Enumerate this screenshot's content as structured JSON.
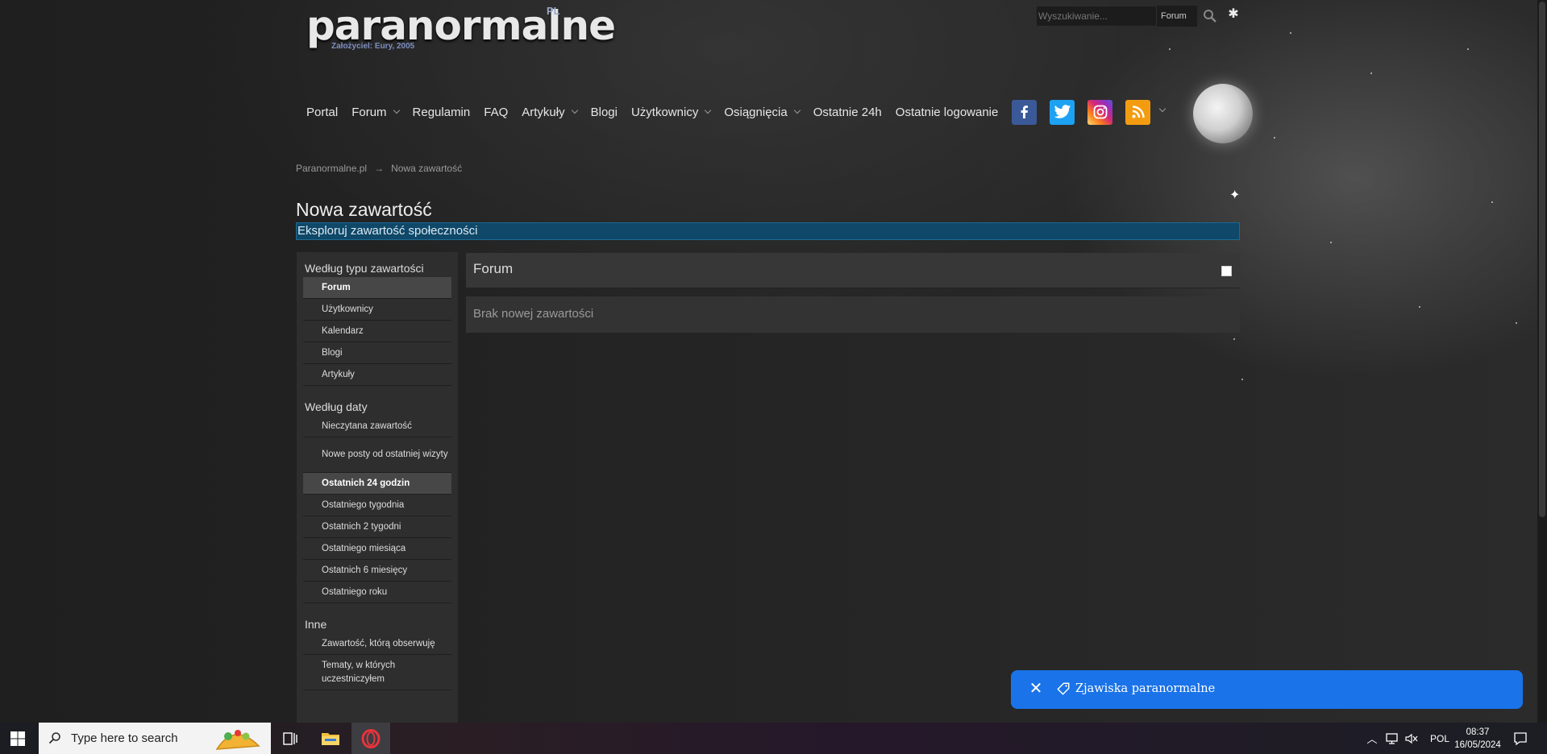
{
  "site": {
    "logo_text": "paranormalne",
    "logo_pl": "PL",
    "logo_sub": "Założyciel: Eury, 2005"
  },
  "search": {
    "placeholder": "Wyszukiwanie...",
    "scope": "Forum"
  },
  "nav": {
    "items": [
      {
        "label": "Portal",
        "dropdown": false
      },
      {
        "label": "Forum",
        "dropdown": true
      },
      {
        "label": "Regulamin",
        "dropdown": false
      },
      {
        "label": "FAQ",
        "dropdown": false
      },
      {
        "label": "Artykuły",
        "dropdown": true
      },
      {
        "label": "Blogi",
        "dropdown": false
      },
      {
        "label": "Użytkownicy",
        "dropdown": true
      },
      {
        "label": "Osiągnięcia",
        "dropdown": true
      },
      {
        "label": "Ostatnie 24h",
        "dropdown": false
      },
      {
        "label": "Ostatnie logowanie",
        "dropdown": false
      }
    ],
    "social": [
      {
        "name": "facebook-icon",
        "color": "#3b5998"
      },
      {
        "name": "twitter-icon",
        "color": "#1da1f2"
      },
      {
        "name": "instagram-icon",
        "color": "#d62976"
      },
      {
        "name": "rss-icon",
        "color": "#f39c12"
      }
    ]
  },
  "breadcrumb": {
    "home": "Paranormalne.pl",
    "separator": "→",
    "current": "Nowa zawartość"
  },
  "page": {
    "title": "Nowa zawartość",
    "description": "Eksploruj zawartość społeczności"
  },
  "sidebar": {
    "sections": [
      {
        "heading": "Według typu zawartości",
        "items": [
          {
            "label": "Forum",
            "active": true
          },
          {
            "label": "Użytkownicy",
            "active": false
          },
          {
            "label": "Kalendarz",
            "active": false
          },
          {
            "label": "Blogi",
            "active": false
          },
          {
            "label": "Artykuły",
            "active": false
          }
        ]
      },
      {
        "heading": "Według daty",
        "items": [
          {
            "label": "Nieczytana zawartość",
            "active": false
          },
          {
            "label": "Nowe posty od ostatniej wizyty",
            "active": false
          },
          {
            "label": "Ostatnich 24 godzin",
            "active": true
          },
          {
            "label": "Ostatniego tygodnia",
            "active": false
          },
          {
            "label": "Ostatnich 2 tygodni",
            "active": false
          },
          {
            "label": "Ostatniego miesiąca",
            "active": false
          },
          {
            "label": "Ostatnich 6 miesięcy",
            "active": false
          },
          {
            "label": "Ostatniego roku",
            "active": false
          }
        ]
      },
      {
        "heading": "Inne",
        "items": [
          {
            "label": "Zawartość, którą obserwuję",
            "active": false
          },
          {
            "label": "Tematy, w których uczestniczyłem",
            "active": false
          }
        ]
      }
    ]
  },
  "main": {
    "panel_title": "Forum",
    "empty_message": "Brak nowej zawartości"
  },
  "toast": {
    "label": "Zjawiska paranormalne",
    "color": "#1a73e8"
  },
  "taskbar": {
    "search_placeholder": "Type here to search",
    "language": "POL",
    "time": "08:37",
    "date": "16/05/2024"
  }
}
